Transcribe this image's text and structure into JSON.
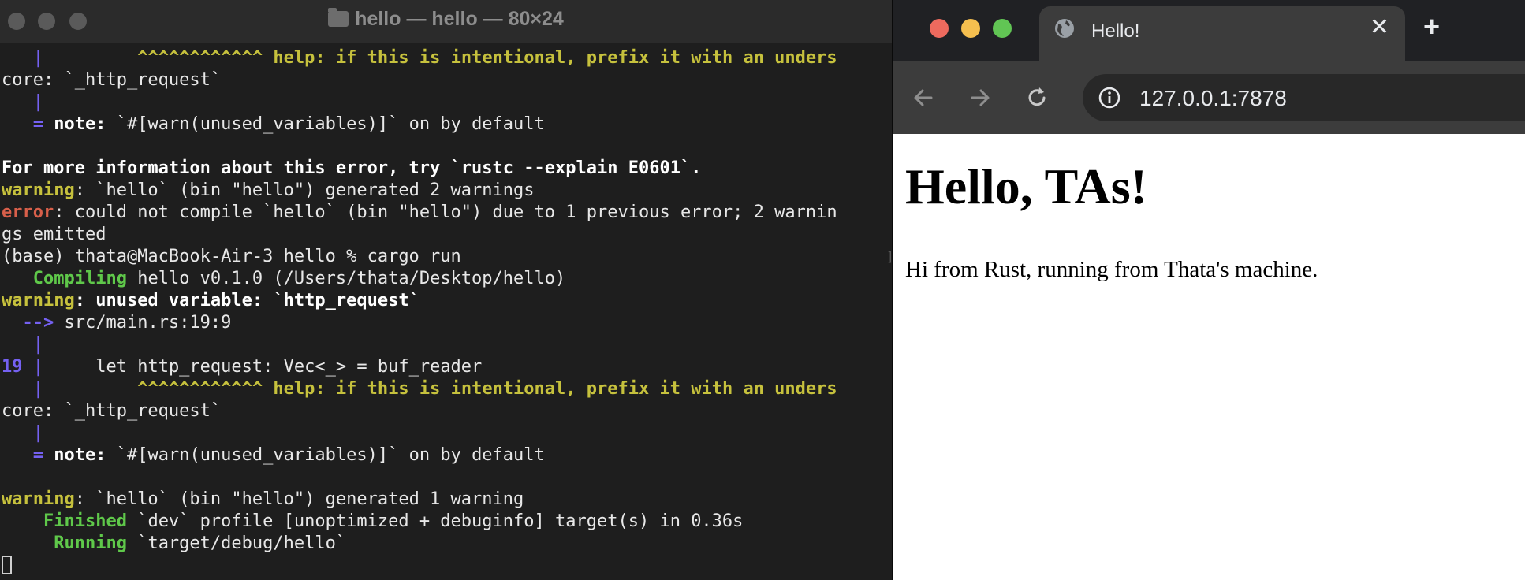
{
  "terminal": {
    "title": "hello — hello — 80×24",
    "lines": [
      {
        "indent": "   ",
        "bar": "|",
        "pad": "         ",
        "carets": "^^^^^^^^^^^^",
        "help": " help: if this is intentional, prefix it with an unders"
      },
      {
        "text": "core: `_http_request`"
      },
      {
        "indent": "   ",
        "bar": "|"
      },
      {
        "indent": "   ",
        "eq": "=",
        "note": " note:",
        "rest": " `#[warn(unused_variables)]` on by default"
      },
      {
        "text": ""
      },
      {
        "text": "For more information about this error, try `rustc --explain E0601`."
      },
      {
        "label": "warning",
        "rest": ": `hello` (bin \"hello\") generated 2 warnings"
      },
      {
        "label": "error",
        "rest": ": could not compile `hello` (bin \"hello\") due to 1 previous error; 2 warnin"
      },
      {
        "text": "gs emitted"
      },
      {
        "text": "(base) thata@MacBook-Air-3 hello % cargo run"
      },
      {
        "indent": "   ",
        "status": "Compiling",
        "rest": " hello v0.1.0 (/Users/thata/Desktop/hello)"
      },
      {
        "label": "warning",
        "rest": ": unused variable: `http_request`"
      },
      {
        "indent": "  ",
        "arrow": "-->",
        "rest": " src/main.rs:19:9"
      },
      {
        "indent": "   ",
        "bar": "|"
      },
      {
        "lineno": "19",
        "bar": " |",
        "rest": "     let http_request: Vec<_> = buf_reader"
      },
      {
        "indent": "   ",
        "bar": "|",
        "pad": "         ",
        "carets": "^^^^^^^^^^^^",
        "help": " help: if this is intentional, prefix it with an unders"
      },
      {
        "text": "core: `_http_request`"
      },
      {
        "indent": "   ",
        "bar": "|"
      },
      {
        "indent": "   ",
        "eq": "=",
        "note": " note:",
        "rest": " `#[warn(unused_variables)]` on by default"
      },
      {
        "text": ""
      },
      {
        "label": "warning",
        "rest": ": `hello` (bin \"hello\") generated 1 warning"
      },
      {
        "indent": "    ",
        "status": "Finished",
        "rest": " `dev` profile [unoptimized + debuginfo] target(s) in 0.36s"
      },
      {
        "indent": "     ",
        "status": "Running",
        "rest": " `target/debug/hello`"
      }
    ]
  },
  "browser": {
    "tab_title": "Hello!",
    "tab_close": "✕",
    "new_tab": "+",
    "url": "127.0.0.1:7878",
    "heading": "Hello, TAs!",
    "paragraph": "Hi from Rust, running from Thata's machine."
  },
  "colors": {
    "terminal_bg": "#1e1e1e",
    "warning_yellow": "#c6c13d",
    "error_red": "#d75f4a",
    "gutter_purple": "#7561f2",
    "status_green": "#5fc84a",
    "browser_chrome": "#3c3c3c"
  },
  "icons": {
    "tab_favicon": "globe-icon",
    "back": "arrow-left-icon",
    "forward": "arrow-right-icon",
    "reload": "reload-icon",
    "site_info": "info-icon"
  }
}
